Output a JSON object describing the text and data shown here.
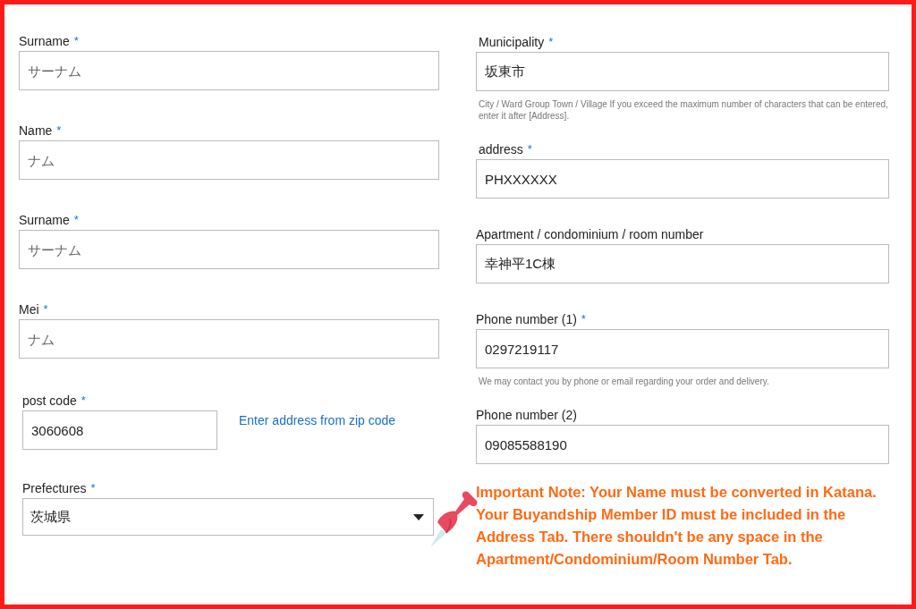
{
  "left_fields": [
    {
      "kind": "text",
      "label": "Surname",
      "asterisk": "*",
      "placeholder": "サーナム"
    },
    {
      "kind": "text",
      "label": "Name",
      "asterisk": "*",
      "placeholder": "ナム"
    },
    {
      "kind": "text",
      "label": "Surname",
      "asterisk": "*",
      "placeholder": "サーナム"
    },
    {
      "kind": "text",
      "label": "Mei",
      "asterisk": "*",
      "placeholder": "ナム"
    },
    {
      "kind": "postcode",
      "label": "post code",
      "asterisk": "*",
      "value": "3060608",
      "link": "Enter address from zip code"
    },
    {
      "kind": "select",
      "label": "Prefectures",
      "asterisk": "*",
      "value": "茨城県"
    }
  ],
  "right_fields": [
    {
      "kind": "text",
      "label": "Municipality",
      "asterisk": "*",
      "value": "坂東市",
      "hint": "City / Ward Group Town / Village If you exceed the maximum number of characters that can be entered, enter it after [Address]."
    },
    {
      "kind": "text",
      "label": "address",
      "asterisk": "*",
      "value": "PHXXXXXX"
    },
    {
      "kind": "text",
      "label": "Apartment / condominium / room number",
      "value": "幸神平1C棟"
    },
    {
      "kind": "text",
      "label": "Phone number (1)",
      "asterisk": "*",
      "value": "0297219117",
      "hint": "We may contact you by phone or email regarding your order and delivery."
    },
    {
      "kind": "text",
      "label": "Phone number (2)",
      "value": "09085588190"
    }
  ],
  "note": "Important Note: Your Name must be converted in Katana. Your Buyandship Member ID must be included in the Address Tab. There shouldn't be any space in the Apartment/Condominium/Room Number Tab."
}
